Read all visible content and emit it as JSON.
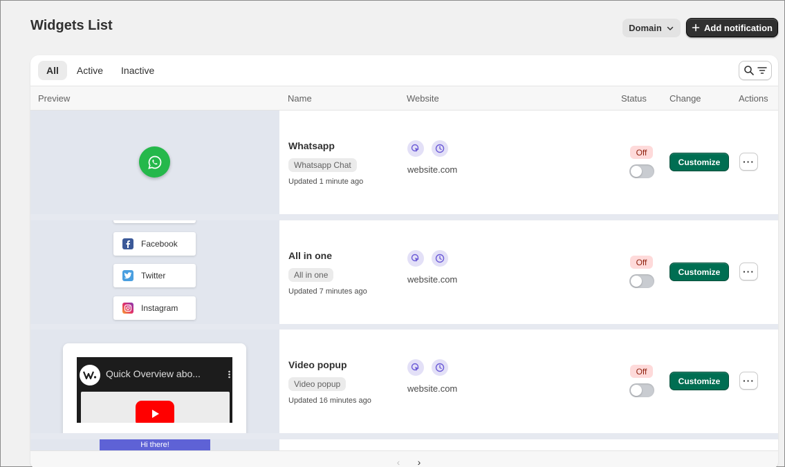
{
  "header": {
    "title": "Widgets List",
    "domain_label": "Domain",
    "add_label": "Add notification"
  },
  "tabs": [
    {
      "label": "All",
      "active": true
    },
    {
      "label": "Active",
      "active": false
    },
    {
      "label": "Inactive",
      "active": false
    }
  ],
  "columns": {
    "preview": "Preview",
    "name": "Name",
    "website": "Website",
    "status": "Status",
    "change": "Change",
    "actions": "Actions"
  },
  "rows": [
    {
      "name": "Whatsapp",
      "tag": "Whatsapp Chat",
      "updated": "Updated 1 minute ago",
      "website": "website.com",
      "status": "Off",
      "enabled": false,
      "customize_label": "Customize",
      "more_label": "···"
    },
    {
      "name": "All in one",
      "tag": "All in one",
      "updated": "Updated 7 minutes ago",
      "website": "website.com",
      "status": "Off",
      "enabled": false,
      "customize_label": "Customize",
      "more_label": "···"
    },
    {
      "name": "Video popup",
      "tag": "Video popup",
      "updated": "Updated 16 minutes ago",
      "website": "website.com",
      "status": "Off",
      "enabled": false,
      "customize_label": "Customize",
      "more_label": "···"
    }
  ],
  "preview_content": {
    "social_buttons": [
      "Facebook",
      "Twitter",
      "Instagram"
    ],
    "video_title": "Quick Overview abo...",
    "hi_banner": "Hi there!"
  },
  "pager": {
    "prev": "‹",
    "next": "›"
  },
  "colors": {
    "primary_button": "#303030",
    "customize": "#006e52",
    "off_badge_bg": "#fedada",
    "whatsapp": "#25b84b",
    "icon_accent": "#6b5bd6"
  }
}
